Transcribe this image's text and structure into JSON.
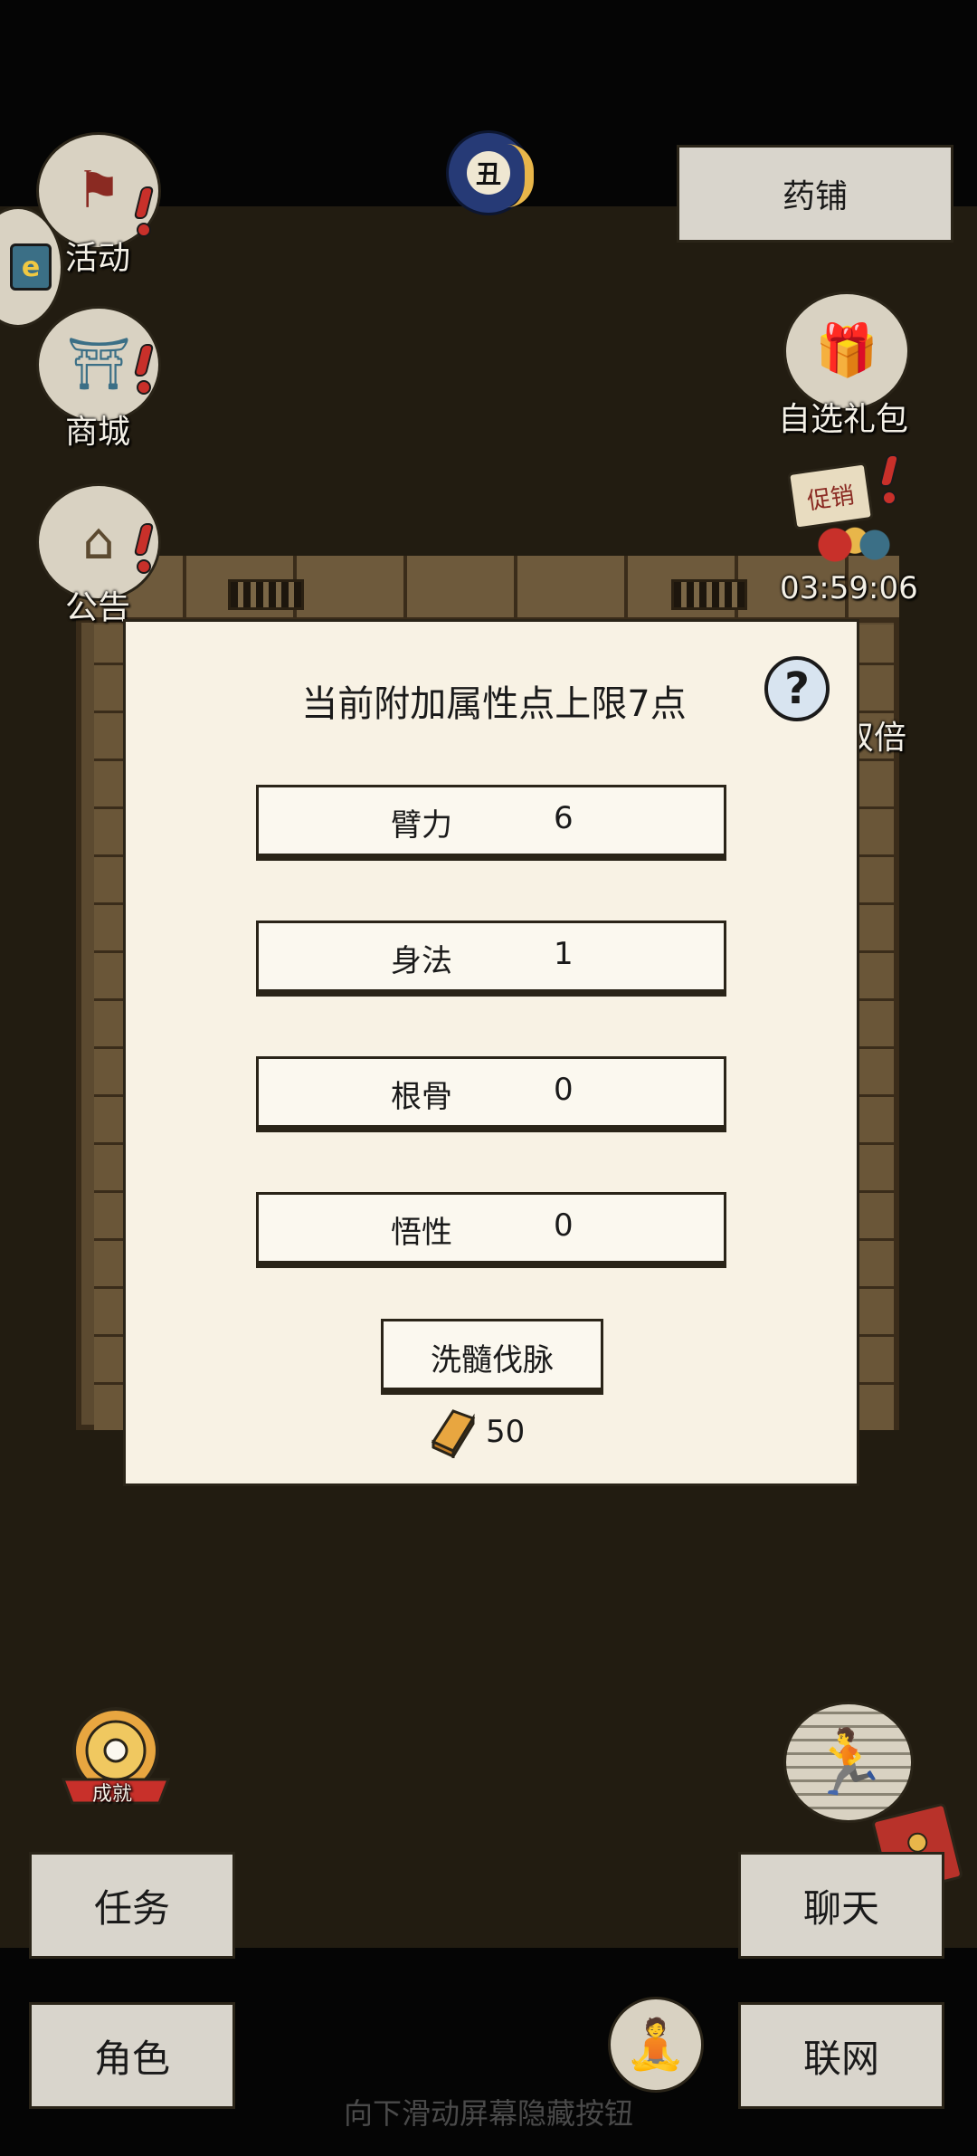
{
  "top": {
    "shop_button": "药铺"
  },
  "left_menu": [
    {
      "label": "活动",
      "icon": "banner-flag-icon"
    },
    {
      "label": "商城",
      "icon": "storefront-icon"
    },
    {
      "label": "公告",
      "icon": "notice-pavilion-icon"
    }
  ],
  "right_menu": {
    "gift_pack": "自选礼包",
    "promo_sign": "促销",
    "promo_timer": "03:59:06",
    "double_label": "双倍"
  },
  "dialog": {
    "title": "当前附加属性点上限7点",
    "help": "?",
    "stats": [
      {
        "name": "臂力",
        "value": "6"
      },
      {
        "name": "身法",
        "value": "1"
      },
      {
        "name": "根骨",
        "value": "0"
      },
      {
        "name": "悟性",
        "value": "0"
      }
    ],
    "reset_button": "洗髓伐脉",
    "cost": "50"
  },
  "bottom": {
    "achievement_label": "成就",
    "task_button": "任务",
    "role_button": "角色",
    "chat_button": "聊天",
    "network_button": "联网",
    "hint": "向下滑动屏幕隐藏按钮"
  },
  "colors": {
    "background": "#221c11",
    "panel": "#f8f2e4",
    "button": "#d9d5cc",
    "alert_red": "#c8302a",
    "gold": "#e8a640"
  }
}
